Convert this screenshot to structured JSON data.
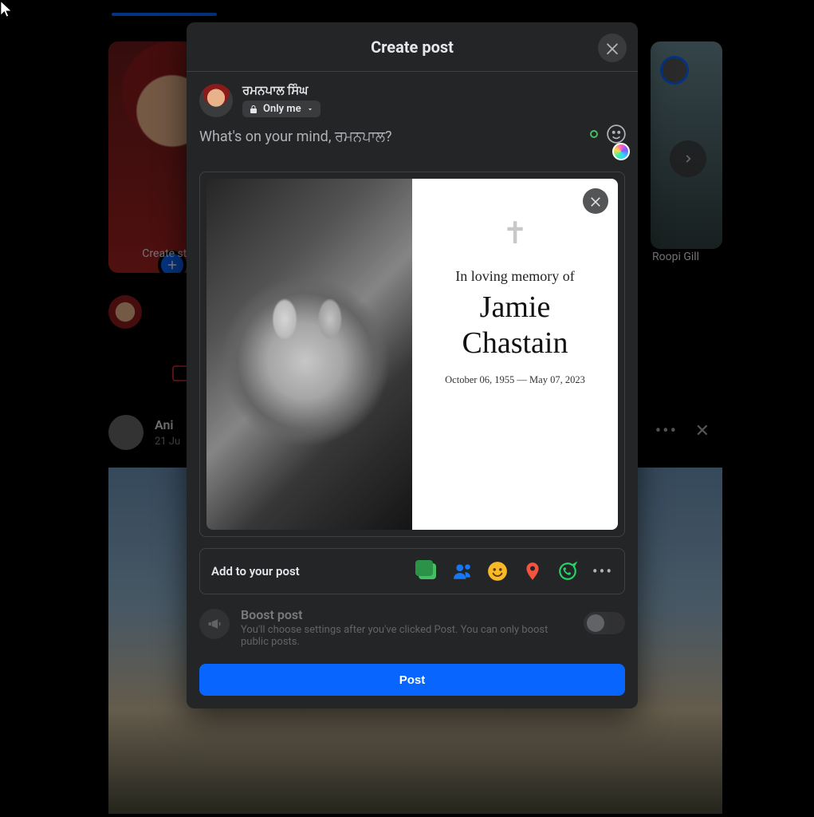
{
  "nav": {
    "active_tab": "home"
  },
  "stories": {
    "create_label": "Create story",
    "right_name": "Roopi Gill"
  },
  "feed": {
    "post_author": "Ani",
    "post_date": "21 Ju"
  },
  "modal": {
    "title": "Create post",
    "user_name": "ਰਮਨਪਾਲ ਸਿੰਘ",
    "audience": "Only me",
    "placeholder": "What's on your mind, ਰਮਨਪਾਲ?",
    "media": {
      "memorial_script": "In loving memory of",
      "memorial_name_1": "Jamie",
      "memorial_name_2": "Chastain",
      "memorial_dates": "October 06, 1955 — May 07, 2023"
    },
    "add_to_post": "Add to your post",
    "boost": {
      "title": "Boost post",
      "desc": "You'll choose settings after you've clicked Post. You can only boost public posts."
    },
    "post_button": "Post"
  }
}
